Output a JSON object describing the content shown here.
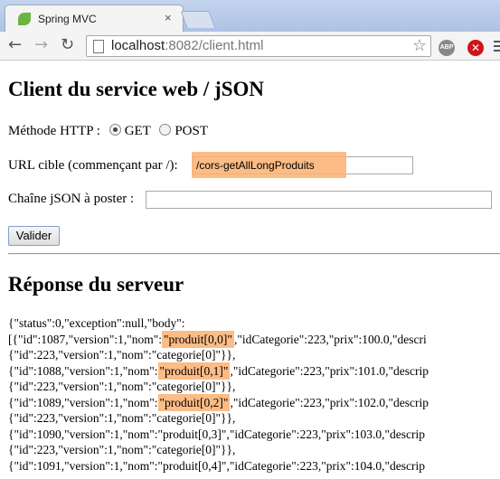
{
  "browser": {
    "tab_title": "Spring MVC",
    "tab_close": "×",
    "url_host": "localhost",
    "url_path": ":8082/client.html",
    "abp_label": "ABP",
    "block_icon": "✕",
    "icons": {
      "back": "back-arrow-icon",
      "forward": "forward-arrow-icon",
      "reload": "reload-icon",
      "star": "star-icon",
      "menu": "hamburger-menu-icon"
    }
  },
  "page": {
    "title": "Client du service web / jSON",
    "method_label": "Méthode HTTP :",
    "method_options": [
      {
        "label": "GET",
        "checked": true
      },
      {
        "label": "POST",
        "checked": false
      }
    ],
    "url_label": "URL cible (commençant par /):",
    "url_value": "/cors-getAllLongProduits",
    "json_label": "Chaîne jSON à poster :",
    "json_value": "",
    "submit_label": "Valider",
    "response_title": "Réponse du serveur",
    "response_head": "{\"status\":0,\"exception\":null,\"body\":",
    "response_rows": [
      {
        "prefix": "[{\"id\":1087,\"version\":1,\"nom\":",
        "name": "\"produit[0,0]\"",
        "highlight": true,
        "suffix": ",\"idCategorie\":223,\"prix\":100.0,\"descri",
        "cat": "{\"id\":223,\"version\":1,\"nom\":\"categorie[0]\"}},"
      },
      {
        "prefix": "{\"id\":1088,\"version\":1,\"nom\":",
        "name": "\"produit[0,1]\"",
        "highlight": true,
        "suffix": ",\"idCategorie\":223,\"prix\":101.0,\"descrip",
        "cat": "{\"id\":223,\"version\":1,\"nom\":\"categorie[0]\"}},"
      },
      {
        "prefix": "{\"id\":1089,\"version\":1,\"nom\":",
        "name": "\"produit[0,2]\"",
        "highlight": true,
        "suffix": ",\"idCategorie\":223,\"prix\":102.0,\"descrip",
        "cat": "{\"id\":223,\"version\":1,\"nom\":\"categorie[0]\"}},"
      },
      {
        "prefix": "{\"id\":1090,\"version\":1,\"nom\":",
        "name": "\"produit[0,3]\"",
        "highlight": false,
        "suffix": ",\"idCategorie\":223,\"prix\":103.0,\"descrip",
        "cat": "{\"id\":223,\"version\":1,\"nom\":\"categorie[0]\"}},"
      },
      {
        "prefix": "{\"id\":1091,\"version\":1,\"nom\":",
        "name": "\"produit[0,4]\"",
        "highlight": false,
        "suffix": ",\"idCategorie\":223,\"prix\":104.0,\"descrip",
        "cat": ""
      }
    ]
  }
}
